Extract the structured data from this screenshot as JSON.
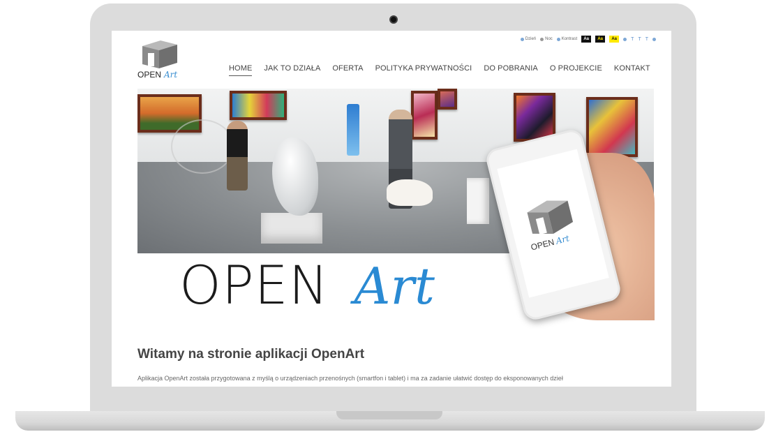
{
  "access_bar": {
    "theme_day": "Dzień",
    "theme_night": "Noc",
    "theme_contrast": "Kontrast",
    "contrast_options": [
      "Aa",
      "Aa",
      "Aa"
    ],
    "font_sizes": [
      "T",
      "T",
      "T"
    ]
  },
  "logo": {
    "open": "OPEN",
    "art": "Art"
  },
  "nav": {
    "items": [
      {
        "label": "HOME",
        "active": true
      },
      {
        "label": "JAK TO DZIAŁA"
      },
      {
        "label": "OFERTA"
      },
      {
        "label": "POLITYKA PRYWATNOŚCI"
      },
      {
        "label": "DO POBRANIA"
      },
      {
        "label": "O PROJEKCIE"
      },
      {
        "label": "KONTAKT"
      }
    ]
  },
  "hero": {
    "brand_open": "OPEN",
    "brand_art": "Art",
    "phone_logo_open": "OPEN",
    "phone_logo_art": "Art"
  },
  "welcome": {
    "title": "Witamy na stronie aplikacji OpenArt",
    "text": "Aplikacja OpenArt została przygotowana z myślą o urządzeniach przenośnych (smartfon i tablet) i ma za zadanie ułatwić dostęp do eksponowanych dzieł"
  },
  "colors": {
    "accent": "#3b8fd1",
    "text_dark": "#1b1b1b",
    "frame": "#dcdcdc"
  }
}
